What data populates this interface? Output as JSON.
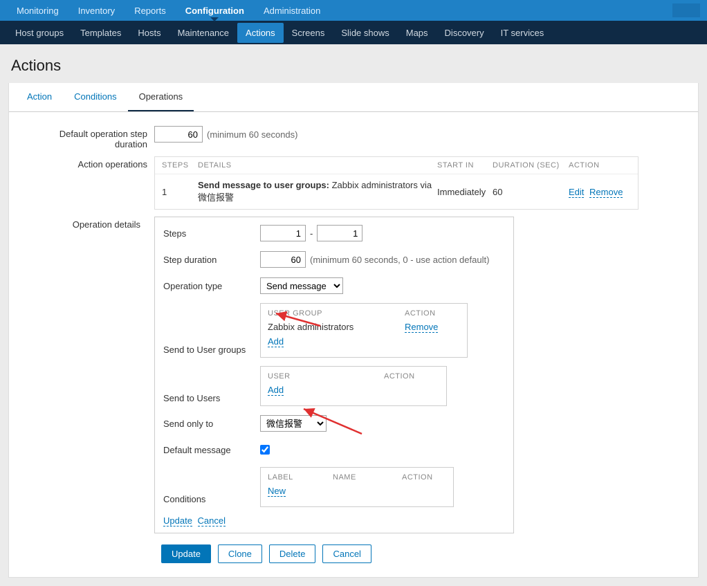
{
  "topnav": {
    "items": [
      {
        "label": "Monitoring"
      },
      {
        "label": "Inventory"
      },
      {
        "label": "Reports"
      },
      {
        "label": "Configuration",
        "active": true
      },
      {
        "label": "Administration"
      }
    ]
  },
  "subnav": {
    "items": [
      {
        "label": "Host groups"
      },
      {
        "label": "Templates"
      },
      {
        "label": "Hosts"
      },
      {
        "label": "Maintenance"
      },
      {
        "label": "Actions",
        "active": true
      },
      {
        "label": "Screens"
      },
      {
        "label": "Slide shows"
      },
      {
        "label": "Maps"
      },
      {
        "label": "Discovery"
      },
      {
        "label": "IT services"
      }
    ]
  },
  "page": {
    "title": "Actions"
  },
  "tabs": {
    "items": [
      {
        "label": "Action"
      },
      {
        "label": "Conditions"
      },
      {
        "label": "Operations",
        "active": true
      }
    ]
  },
  "form": {
    "default_step_label": "Default operation step duration",
    "default_step_value": "60",
    "default_step_hint": "(minimum 60 seconds)",
    "action_ops_label": "Action operations",
    "ops_headers": {
      "steps": "STEPS",
      "details": "DETAILS",
      "startin": "START IN",
      "duration": "DURATION (SEC)",
      "action": "ACTION"
    },
    "ops_row": {
      "step": "1",
      "details_prefix": "Send message to user groups:",
      "details_text": " Zabbix administrators via 微信报警",
      "startin": "Immediately",
      "duration": "60",
      "edit": "Edit",
      "remove": "Remove"
    },
    "op_details_label": "Operation details",
    "details": {
      "steps_label": "Steps",
      "steps_from": "1",
      "steps_sep": "-",
      "steps_to": "1",
      "step_dur_label": "Step duration",
      "step_dur_value": "60",
      "step_dur_hint": "(minimum 60 seconds, 0 - use action default)",
      "op_type_label": "Operation type",
      "op_type_value": "Send message",
      "send_ug_label": "Send to User groups",
      "ug_header": "USER GROUP",
      "ug_action": "ACTION",
      "ug_value": "Zabbix administrators",
      "ug_remove": "Remove",
      "ug_add": "Add",
      "send_u_label": "Send to Users",
      "u_header": "USER",
      "u_action": "ACTION",
      "u_add": "Add",
      "send_only_label": "Send only to",
      "send_only_value": "微信报警",
      "default_msg_label": "Default message",
      "default_msg_checked": true,
      "cond_label": "Conditions",
      "cond_h_label": "LABEL",
      "cond_h_name": "NAME",
      "cond_h_action": "ACTION",
      "cond_new": "New",
      "update": "Update",
      "cancel": "Cancel"
    }
  },
  "buttons": {
    "update": "Update",
    "clone": "Clone",
    "delete": "Delete",
    "cancel": "Cancel"
  }
}
